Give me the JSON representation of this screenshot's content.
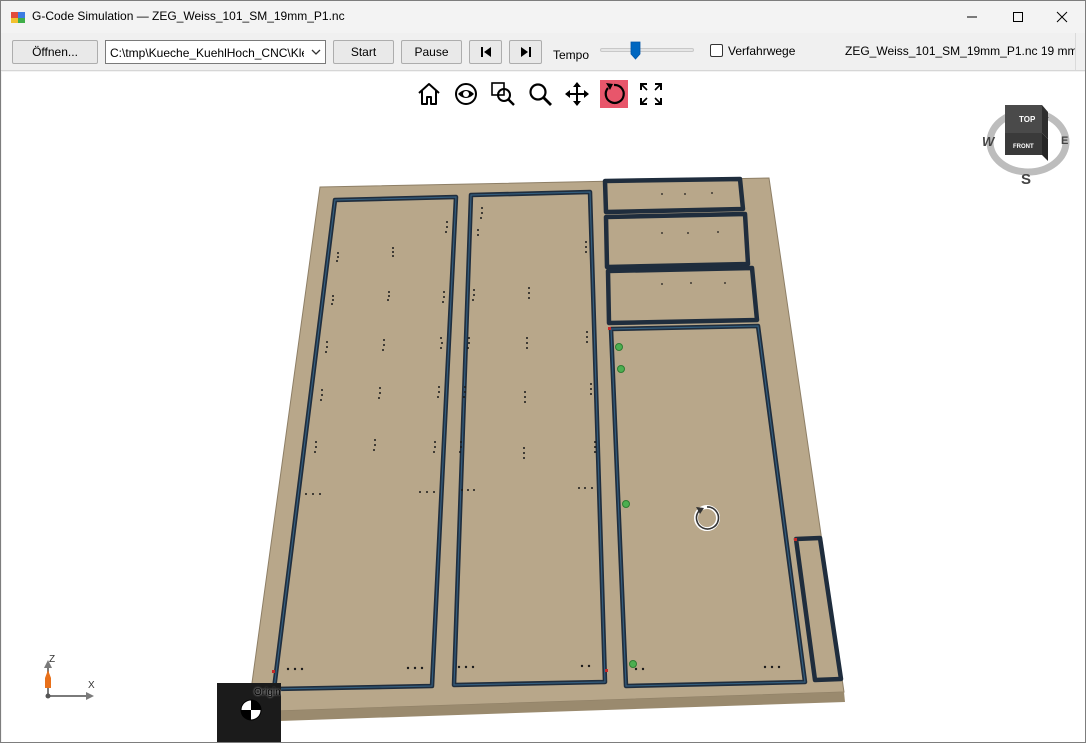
{
  "window": {
    "title": "G-Code Simulation — ZEG_Weiss_101_SM_19mm_P1.nc"
  },
  "toolbar": {
    "open_label": "Öffnen...",
    "path_value": "C:\\tmp\\Kueche_KuehlHoch_CNC\\Kle",
    "start_label": "Start",
    "pause_label": "Pause",
    "tempo_label": "Tempo",
    "tempo_level": 0.4,
    "travel_paths_label": "Verfahrwege",
    "travel_paths_checked": false,
    "file_info": "ZEG_Weiss_101_SM_19mm_P1.nc  19 mm"
  },
  "viewport": {
    "view_tools": [
      "home-icon",
      "eye-icon",
      "zoom-window-icon",
      "zoom-icon",
      "pan-icon",
      "rotate-icon",
      "fit-view-icon"
    ],
    "active_tool": "rotate-icon",
    "view_cube": {
      "top_label": "TOP",
      "front_label": "FRONT",
      "west": "W",
      "east": "E",
      "south": "S"
    },
    "origin_label": "Origin",
    "axis_z": "Z",
    "axis_x": "X"
  },
  "colors": {
    "sheet": "#b8a78a",
    "cut_path": "#1f2d3d",
    "viewport_bg": "#ffffff",
    "active_tool": "#e8566b"
  }
}
